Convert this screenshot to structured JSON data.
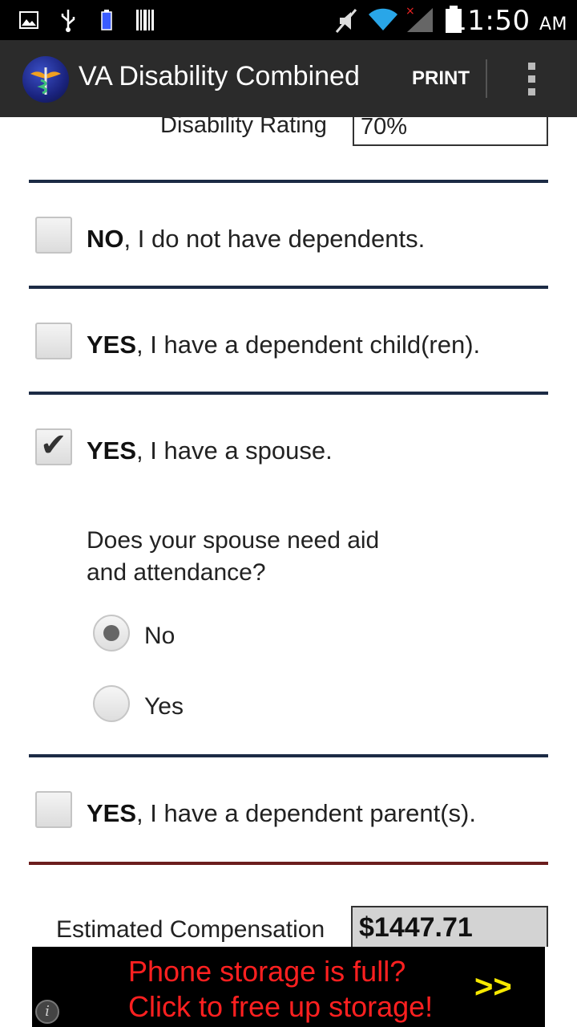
{
  "status_bar": {
    "time": "11:50",
    "ampm": "AM",
    "icons": [
      "image-icon",
      "usb-icon",
      "battery-small-icon",
      "barcode-icon",
      "mute-icon",
      "wifi-icon",
      "signal-icon",
      "battery-icon"
    ]
  },
  "action_bar": {
    "title": "VA Disability Combined",
    "print_label": "PRINT",
    "logo_icon": "caduceus-logo-icon",
    "overflow_icon": "overflow-menu-icon"
  },
  "form": {
    "rating_label": "Disability Rating",
    "rating_value": "70%",
    "options": [
      {
        "bold": "NO",
        "rest": ", I do not have dependents.",
        "checked": false
      },
      {
        "bold": "YES",
        "rest": ", I have a dependent child(ren).",
        "checked": false
      },
      {
        "bold": "YES",
        "rest": ", I have a spouse.",
        "checked": true
      },
      {
        "bold": "YES",
        "rest": ", I have a dependent parent(s).",
        "checked": false
      }
    ],
    "spouse_question_line1": "Does your spouse need aid",
    "spouse_question_line2": "and attendance?",
    "radio_options": [
      {
        "label": "No",
        "selected": true
      },
      {
        "label": "Yes",
        "selected": false
      }
    ],
    "compensation_label": "Estimated Compensation",
    "compensation_value": "$1447.71"
  },
  "ad": {
    "line1": "Phone storage is full?",
    "line2": "Click to free up storage!",
    "arrows": ">>",
    "info_glyph": "i"
  },
  "colors": {
    "divider_blue": "#1c2b45",
    "divider_red": "#6b1d1d",
    "actionbar": "#2b2b2b",
    "ad_text": "#ff2020",
    "ad_arrows": "#f6e800"
  }
}
